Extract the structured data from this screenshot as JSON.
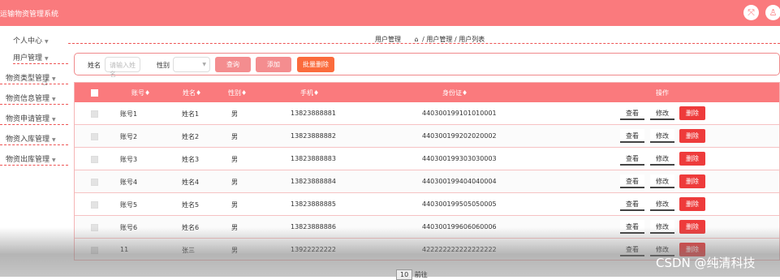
{
  "app": {
    "title": "运输物资管理系统",
    "accent": "#fa7a7d"
  },
  "topbar": {
    "icons": [
      "fullscreen-icon",
      "user-icon"
    ]
  },
  "sidebar": {
    "items": [
      {
        "label": "个人中心"
      },
      {
        "label": "用户管理"
      },
      {
        "label": "物资类型管理"
      },
      {
        "label": "物资信息管理"
      },
      {
        "label": "物资申请管理"
      },
      {
        "label": "物资入库管理"
      },
      {
        "label": "物资出库管理"
      }
    ]
  },
  "breadcrumb": {
    "section": "用户管理",
    "path": [
      "用户管理",
      "用户列表"
    ],
    "separator": "/"
  },
  "search": {
    "name_label": "姓名",
    "name_placeholder": "请输入姓名",
    "gender_label": "性别",
    "gender_value": "",
    "query_button": "查询",
    "add_button": "添加",
    "batch_delete_button": "批量删除"
  },
  "table": {
    "headers": [
      "账号",
      "姓名",
      "性别",
      "手机",
      "身份证",
      "操作"
    ],
    "sort_glyph": "♦",
    "actions": {
      "view": "查看",
      "edit": "修改",
      "delete": "删除"
    },
    "rows": [
      [
        "账号1",
        "姓名1",
        "男",
        "13823888881",
        "440300199101010001"
      ],
      [
        "账号2",
        "姓名2",
        "男",
        "13823888882",
        "440300199202020002"
      ],
      [
        "账号3",
        "姓名3",
        "男",
        "13823888883",
        "440300199303030003"
      ],
      [
        "账号4",
        "姓名4",
        "男",
        "13823888884",
        "440300199404040004"
      ],
      [
        "账号5",
        "姓名5",
        "男",
        "13823888885",
        "440300199505050005"
      ],
      [
        "账号6",
        "姓名6",
        "男",
        "13823888886",
        "440300199606060006"
      ],
      [
        "11",
        "张三",
        "男",
        "13922222222",
        "422222222222222222"
      ]
    ]
  },
  "pager": {
    "page_size": "10",
    "goto_label": "前往"
  },
  "watermark": "CSDN @纯清科技"
}
